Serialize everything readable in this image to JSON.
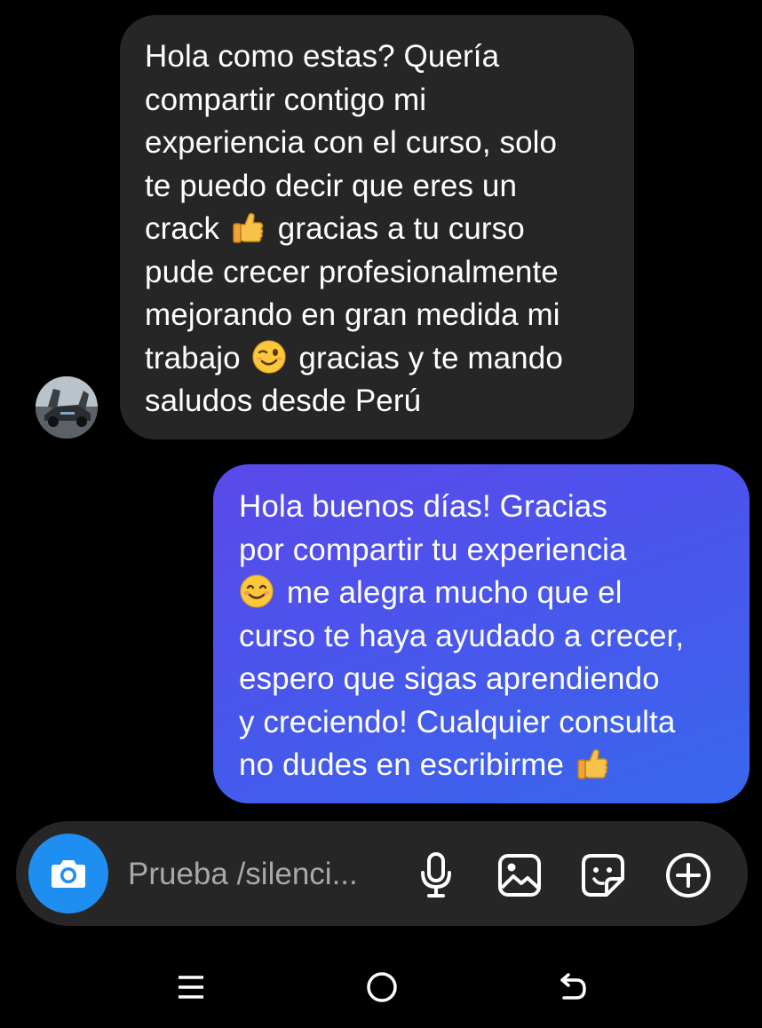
{
  "conversation": {
    "received": {
      "lines": [
        "Hola como estas? Quería",
        "compartir contigo mi",
        "experiencia con el curso, solo",
        "te puedo decir que eres un",
        "crack",
        "gracias a tu curso",
        "pude crecer profesionalmente",
        "mejorando en gran medida mi",
        "trabajo",
        "gracias y te mando",
        "saludos desde Perú"
      ],
      "emojis": [
        "thumbs-up-emoji",
        "winking-face-emoji"
      ]
    },
    "sent": {
      "lines": [
        "Hola buenos días! Gracias",
        "por compartir tu experiencia",
        "me alegra mucho que el",
        "curso te haya ayudado a crecer,",
        "espero que sigas aprendiendo",
        "y creciendo! Cualquier consulta",
        "no dudes en escribirme"
      ],
      "emojis": [
        "smiling-face-emoji",
        "thumbs-up-emoji"
      ]
    }
  },
  "composer": {
    "placeholder": "Prueba /silenci...",
    "icons": [
      "camera-icon",
      "microphone-icon",
      "gallery-icon",
      "sticker-icon",
      "plus-icon"
    ]
  },
  "navigation": {
    "icons": [
      "recent-apps-icon",
      "home-icon",
      "back-icon"
    ]
  },
  "colors": {
    "background": "#000000",
    "received_bubble": "#262626",
    "sent_bubble_start": "#5a49ea",
    "sent_bubble_end": "#3867ec",
    "camera_button": "#1f8ef1",
    "text": "#ffffff",
    "placeholder": "#a8a8a8"
  }
}
